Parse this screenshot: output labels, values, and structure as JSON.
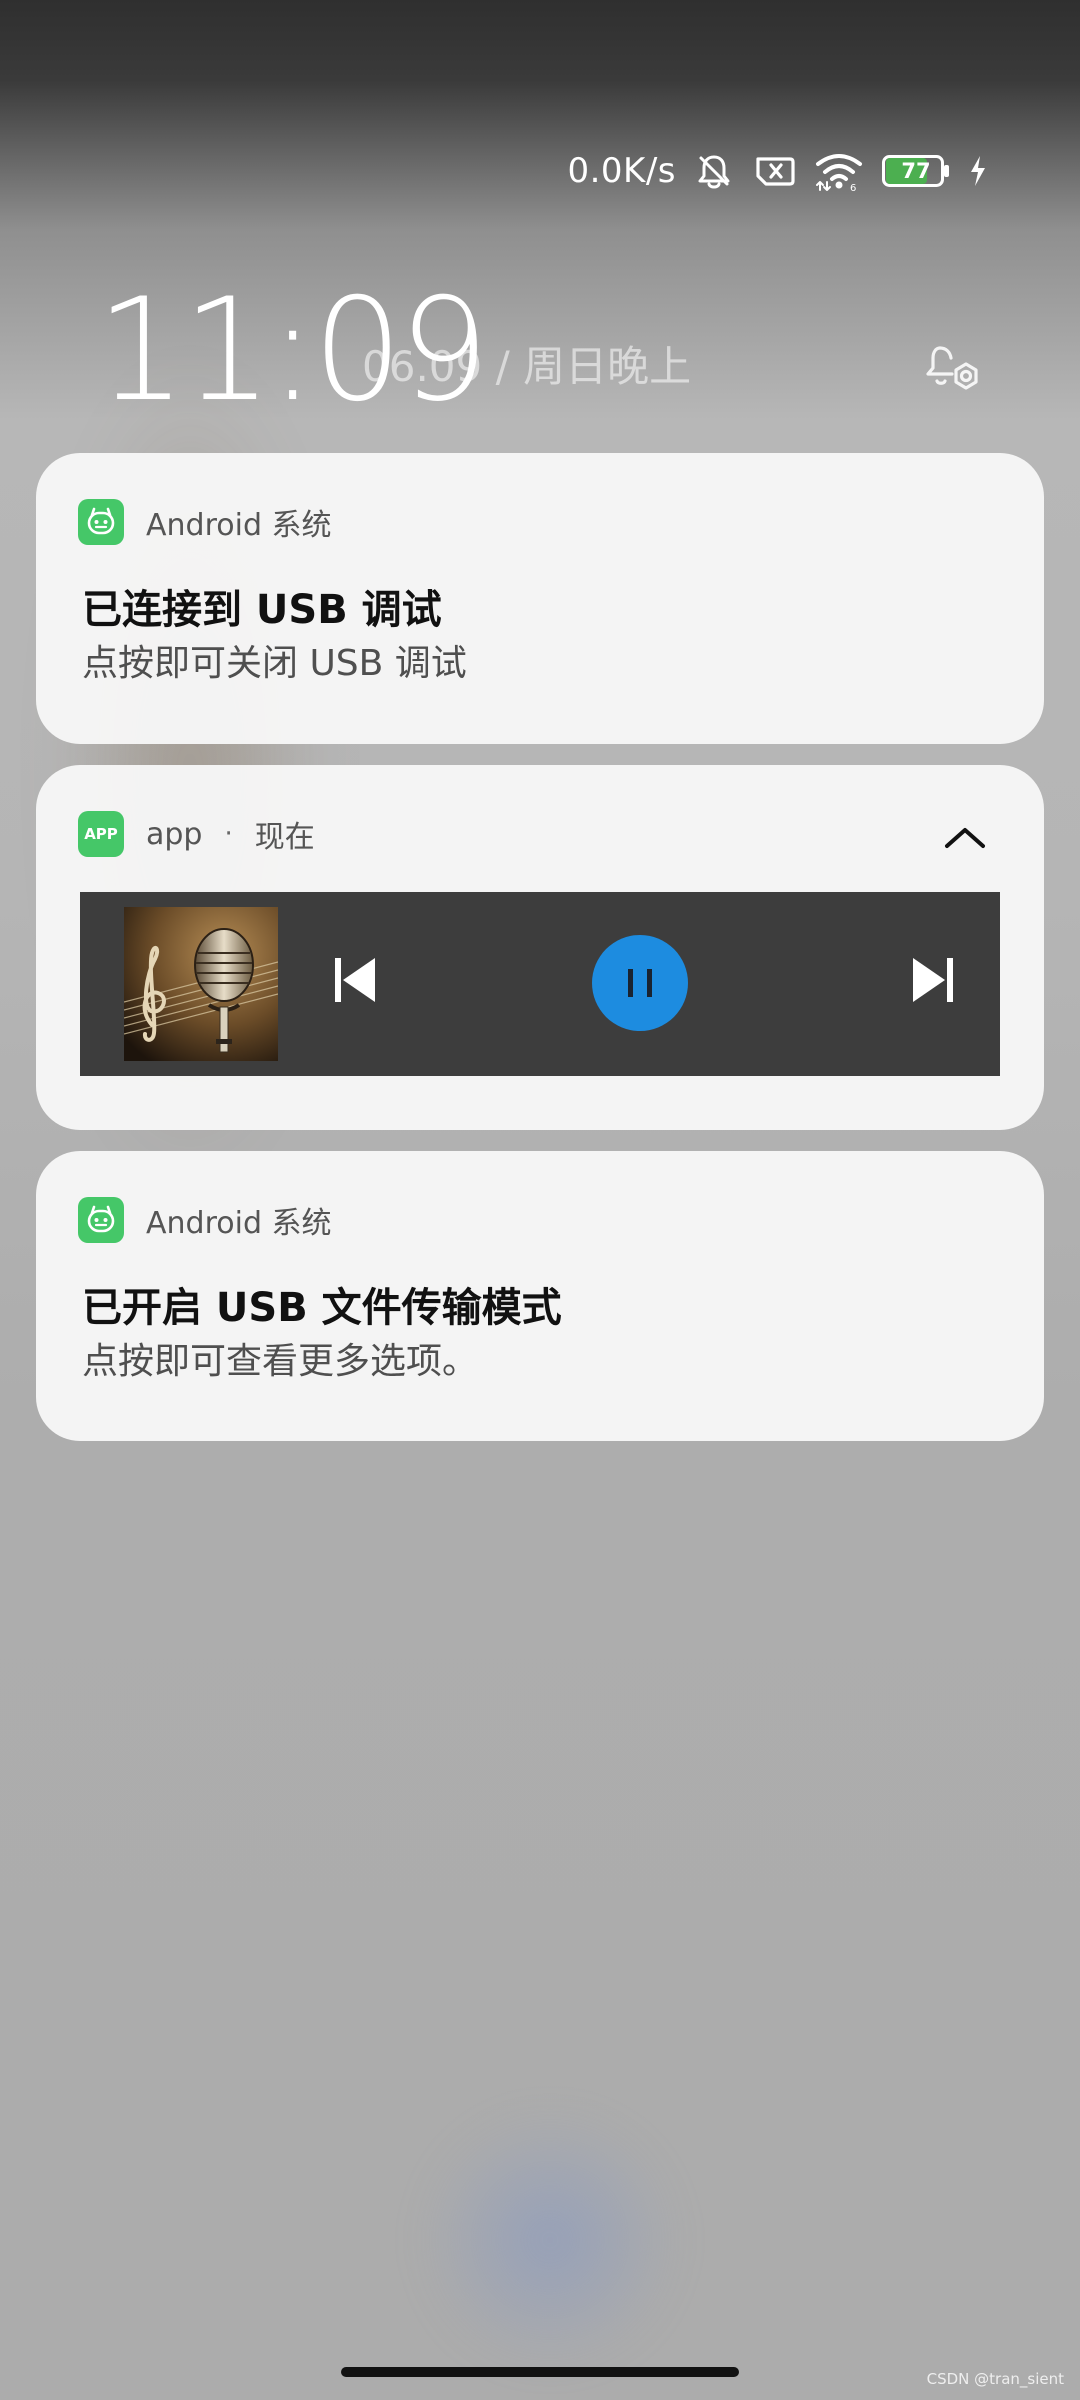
{
  "status_bar": {
    "speed": "0.0K/s",
    "battery_level": 77,
    "battery_text": "77",
    "icons": [
      "bell-off-icon",
      "sim-off-icon",
      "wifi-icon",
      "battery-icon",
      "charging-icon"
    ]
  },
  "lockscreen": {
    "time": "11:09",
    "date": "06.09 / 周日晚上"
  },
  "notifications": [
    {
      "app": "Android 系统",
      "title": "已连接到 USB 调试",
      "text": "点按即可关闭 USB 调试"
    },
    {
      "app_badge": "APP",
      "app": "app",
      "separator": "·",
      "time": "现在"
    },
    {
      "app": "Android 系统",
      "title": "已开启 USB 文件传输模式",
      "text": "点按即可查看更多选项。"
    }
  ],
  "watermark": "CSDN @tran_sient",
  "colors": {
    "badge_green": "#45c768",
    "media_panel": "#3d3d3d",
    "pause_blue": "#1d8ce0",
    "battery_green": "#4caf50"
  }
}
